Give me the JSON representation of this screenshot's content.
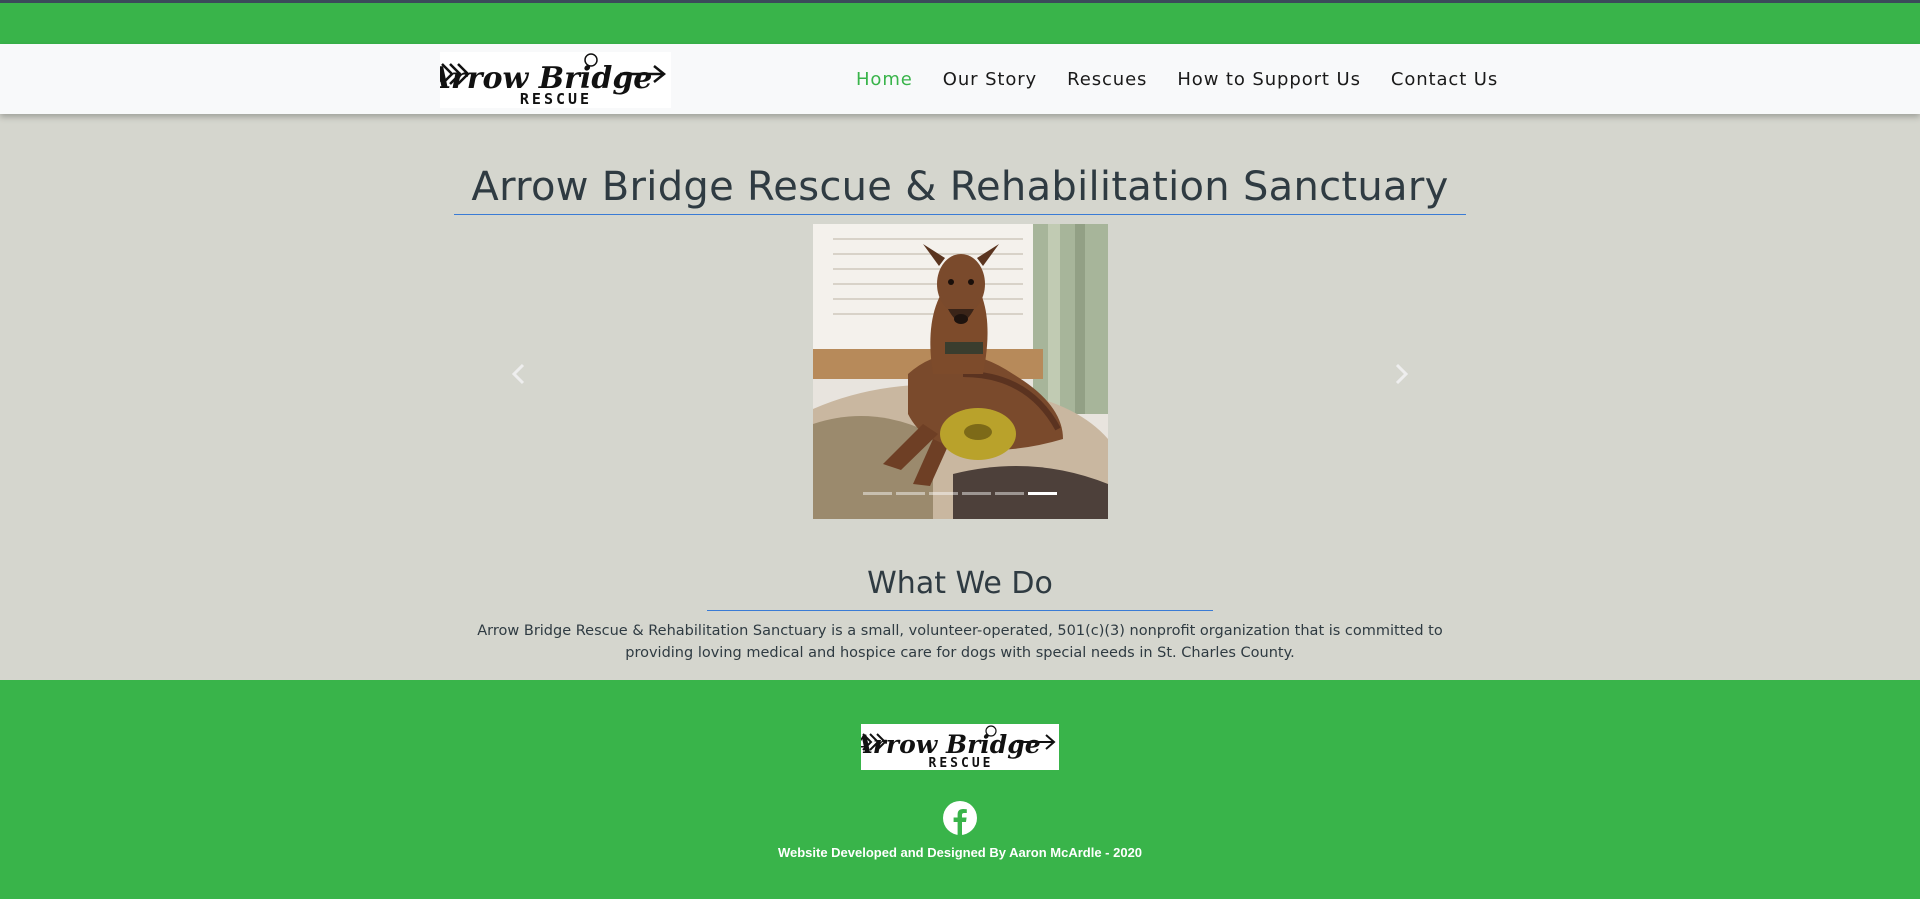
{
  "brand": {
    "logo_word": "Arrow Bridge",
    "logo_sub": "RESCUE"
  },
  "nav": {
    "items": [
      {
        "label": "Home",
        "active": true
      },
      {
        "label": "Our Story",
        "active": false
      },
      {
        "label": "Rescues",
        "active": false
      },
      {
        "label": "How to Support Us",
        "active": false
      },
      {
        "label": "Contact Us",
        "active": false
      }
    ]
  },
  "hero": {
    "title": "Arrow Bridge Rescue & Rehabilitation Sanctuary"
  },
  "carousel": {
    "slide_count": 6,
    "active_index": 5,
    "prev_icon": "chevron-left-icon",
    "next_icon": "chevron-right-icon"
  },
  "what_we_do": {
    "title": "What We Do",
    "text": "Arrow Bridge Rescue & Rehabilitation Sanctuary is a small, volunteer-operated, 501(c)(3) nonprofit organization that is committed to providing loving medical and hospice care for dogs with special needs in St. Charles County."
  },
  "footer": {
    "logo_word": "Arrow Bridge",
    "logo_sub": "RESCUE",
    "social_icon": "facebook-icon",
    "credit": "Website Developed and Designed By Aaron McArdle - 2020"
  },
  "colors": {
    "brand_green": "#39b44a",
    "accent_blue": "#3a7bd5",
    "background": "#d5d6ce",
    "heading": "#2f3b42"
  }
}
